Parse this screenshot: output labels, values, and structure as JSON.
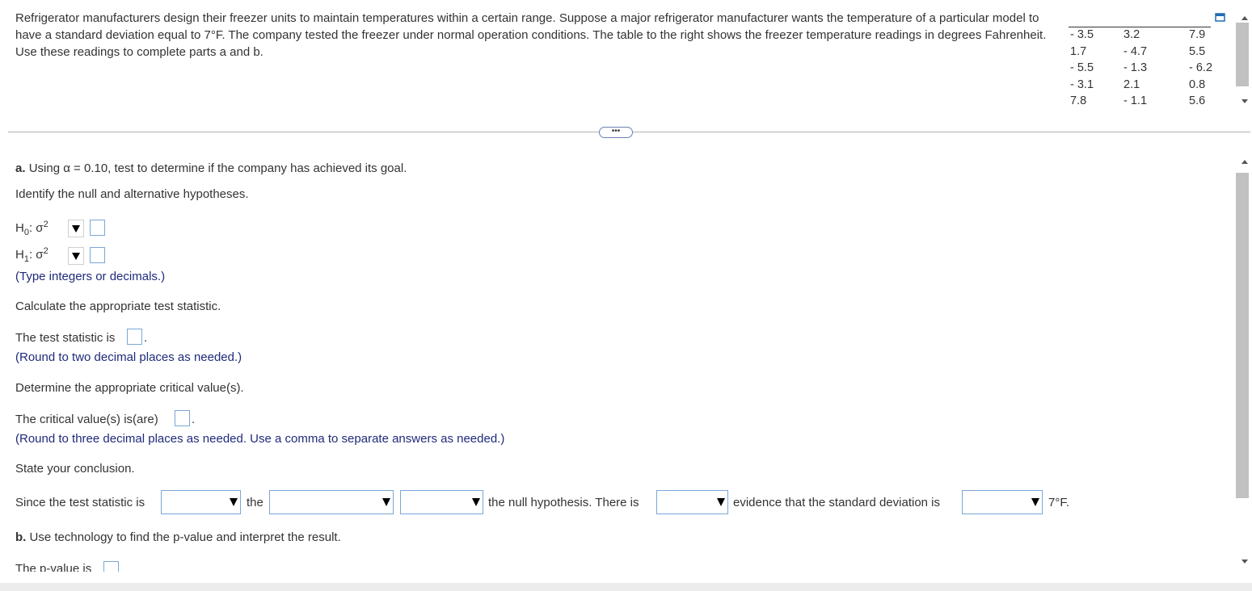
{
  "problem": {
    "text": "Refrigerator manufacturers design their freezer units to maintain temperatures within a certain range. Suppose a major refrigerator manufacturer wants the temperature of a particular model to have a standard deviation equal to 7°F. The company tested the freezer under normal operation conditions. The table to the right shows the freezer temperature readings in degrees Fahrenheit. Use these readings to complete parts a and b.",
    "table": [
      [
        "- 3.5",
        "3.2",
        "7.9"
      ],
      [
        "1.7",
        "- 4.7",
        "5.5"
      ],
      [
        "- 5.5",
        "- 1.3",
        "- 6.2"
      ],
      [
        "- 3.1",
        "2.1",
        "0.8"
      ],
      [
        "7.8",
        "- 1.1",
        "5.6"
      ]
    ]
  },
  "expand_label": "•••",
  "part_a": {
    "label": "a.",
    "prompt": "Using α = 0.10, test to determine if the company has achieved its goal.",
    "identify": "Identify the null and alternative hypotheses.",
    "h0": "H0: σ2",
    "h1": "H1: σ2",
    "type_hint": "(Type integers or decimals.)",
    "calc_stat": "Calculate the appropriate test statistic.",
    "test_stat_label": "The test statistic is",
    "test_stat_hint": "(Round to two decimal places as needed.)",
    "determine_crit": "Determine the appropriate critical value(s).",
    "crit_label": "The critical value(s) is(are)",
    "crit_hint": "(Round to three decimal places as needed. Use a comma to separate answers as needed.)",
    "state_conclusion": "State your conclusion.",
    "conclusion": {
      "since": "Since the test statistic is",
      "the": "the",
      "null_hypothesis": "the null hypothesis. There is",
      "evidence": "evidence that the standard deviation is",
      "value": "7°F."
    }
  },
  "part_b": {
    "label": "b.",
    "prompt": "Use technology to find the p-value and interpret the result.",
    "pvalue_label": "The p-value is"
  }
}
